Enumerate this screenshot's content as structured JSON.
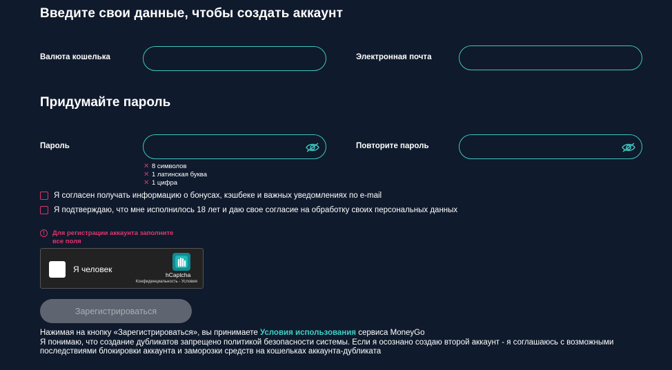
{
  "form": {
    "title": "Введите свои данные, чтобы создать аккаунт",
    "wallet_currency_label": "Валюта кошелька",
    "wallet_currency_value": "",
    "email_label": "Электронная почта",
    "email_value": "",
    "password_title": "Придумайте пароль",
    "password_label": "Пароль",
    "password_value": "",
    "repeat_password_label": "Повторите пароль",
    "repeat_password_value": ""
  },
  "password_rules": [
    {
      "mark": "✕",
      "text": "8 символов"
    },
    {
      "mark": "✕",
      "text": "1 латинская буква"
    },
    {
      "mark": "✕",
      "text": "1 цифра"
    }
  ],
  "consents": {
    "bonuses": "Я согласен получать информацию о бонусах, кэшбеке и важных уведомлениях по e-mail",
    "age": "Я подтверждаю, что мне исполнилось 18 лет и даю свое согласие на обработку своих персональных данных"
  },
  "warning": {
    "icon": "!",
    "line1": "Для регистрации аккаунта заполните",
    "line2": "все поля"
  },
  "captcha": {
    "label": "Я человек",
    "brand": "hCaptcha",
    "links": "Конфиденциальность - Условия"
  },
  "submit_label": "Зарегистрироваться",
  "legal": {
    "prefix": "Нажимая на кнопку «Зарегистрироваться», вы принимаете ",
    "link": "Условия использования",
    "suffix": " сервиса MoneyGo",
    "notice": "Я понимаю, что создание дубликатов запрещено политикой безопасности системы. Если я осознано создаю второй аккаунт - я соглашаюсь с возможными последствиями блокировки аккаунта и заморозки средств на кошельках аккаунта-дубликата"
  },
  "colors": {
    "background": "#0f1a2c",
    "accent": "#3fc6be",
    "error": "#e0356e",
    "button_disabled": "#5f6570"
  }
}
